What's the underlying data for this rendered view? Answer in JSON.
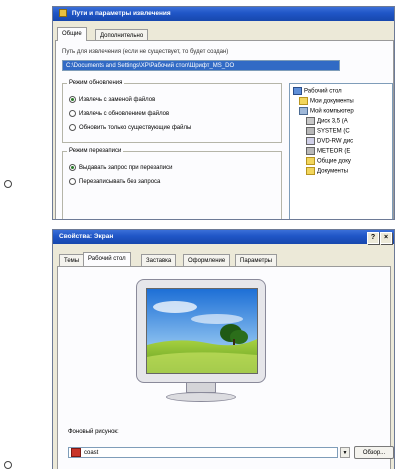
{
  "window1": {
    "title": "Пути и параметры извлечения",
    "tabs": [
      "Общие",
      "Дополнительно"
    ],
    "path_label": "Путь для извлечения (если не существует, то будет создан)",
    "path_value": "C:\\Documents and Settings\\XP\\Рабочий стол\\Шрифт_MS_DO",
    "update_group": {
      "title": "Режим обновления",
      "options": [
        {
          "label": "Извлечь с заменой файлов",
          "selected": true
        },
        {
          "label": "Извлечь с обновлением файлов",
          "selected": false
        },
        {
          "label": "Обновить только существующие файлы",
          "selected": false
        }
      ]
    },
    "overwrite_group": {
      "title": "Режим перезаписи",
      "options": [
        {
          "label": "Выдавать запрос при перезаписи",
          "selected": true
        },
        {
          "label": "Перезаписывать без запроса",
          "selected": false
        }
      ]
    },
    "tree": [
      {
        "label": "Рабочий стол",
        "level": 0,
        "icon": "desktop-icon"
      },
      {
        "label": "Мои документы",
        "level": 1,
        "icon": "folder-icon"
      },
      {
        "label": "Мой компьютер",
        "level": 1,
        "icon": "computer-icon"
      },
      {
        "label": "Диск 3,5 (A",
        "level": 2,
        "icon": "floppy-icon"
      },
      {
        "label": "SYSTEM (C",
        "level": 2,
        "icon": "drive-icon"
      },
      {
        "label": "DVD-RW дис",
        "level": 2,
        "icon": "dvd-icon"
      },
      {
        "label": "METEOR (E",
        "level": 2,
        "icon": "drive-icon"
      },
      {
        "label": "Общие доку",
        "level": 2,
        "icon": "folder-icon"
      },
      {
        "label": "Документы",
        "level": 2,
        "icon": "folder-icon"
      }
    ]
  },
  "window2": {
    "title": "Свойства: Экран",
    "help_label": "?",
    "close_label": "×",
    "tabs": [
      "Темы",
      "Рабочий стол",
      "Заставка",
      "Оформление",
      "Параметры"
    ],
    "active_tab": 1,
    "background_label": "Фоновый рисунок:",
    "background_value": "coast",
    "browse_button": "Обзор..."
  },
  "colors": {
    "title_blue": "#1f55c6",
    "path_highlight": "#316ac5",
    "dialog_bg": "#ece9d8"
  }
}
